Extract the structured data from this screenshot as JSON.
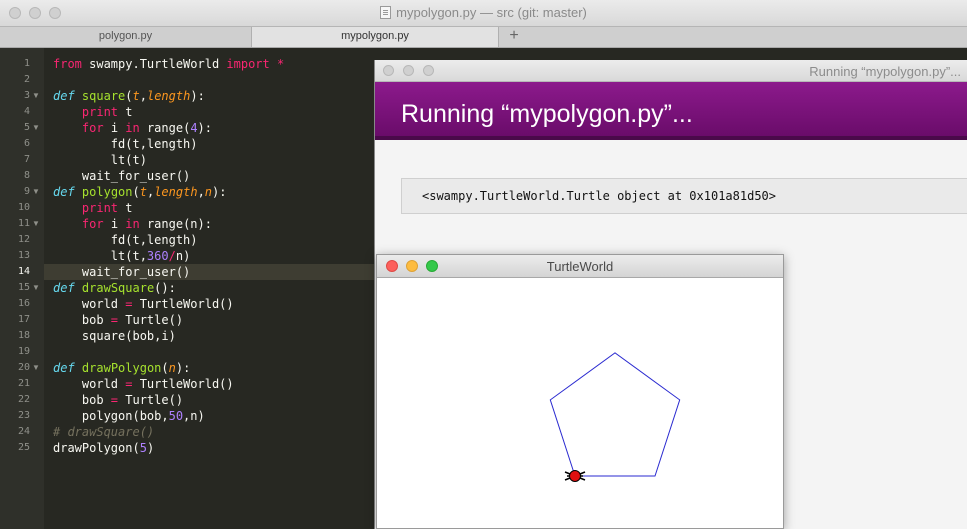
{
  "editor": {
    "window_title": "mypolygon.py — src (git: master)",
    "tabs": [
      {
        "label": "polygon.py"
      },
      {
        "label": "mypolygon.py"
      }
    ],
    "add_tab_symbol": "+",
    "current_line": 14
  },
  "running_window": {
    "titlebar": "Running “mypolygon.py”...",
    "heading": "Running “mypolygon.py”...",
    "output": "<swampy.TurtleWorld.Turtle object at 0x101a81d50>",
    "header_color": "#7d137d"
  },
  "turtle_window": {
    "title": "TurtleWorld",
    "polygon_sides": 5,
    "polygon_length": 50,
    "line_color": "#2a2ad0",
    "turtle_color": "#e01010"
  }
}
